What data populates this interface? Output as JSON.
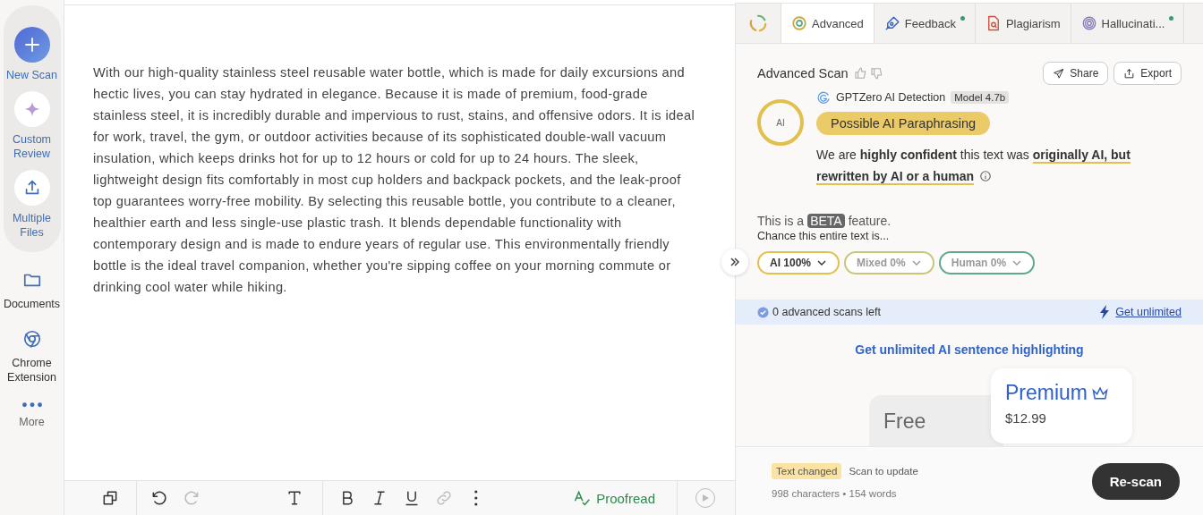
{
  "sidebar": {
    "actions": [
      {
        "label": "New Scan",
        "kind": "plus"
      },
      {
        "label": "Custom Review",
        "kind": "sparkle"
      },
      {
        "label": "Multiple Files",
        "kind": "upload"
      }
    ],
    "links": [
      {
        "label": "Documents",
        "kind": "folder"
      },
      {
        "label": "Chrome Extension",
        "kind": "chrome"
      },
      {
        "label": "More",
        "kind": "dots"
      }
    ]
  },
  "editor": {
    "text": "With our high-quality stainless steel reusable water bottle, which is made for daily excursions and hectic lives, you can stay hydrated in elegance. Because it is made of premium, food-grade stainless steel, it is incredibly durable and impervious to rust, stains, and offensive odors. It is ideal for work, travel, the gym, or outdoor activities because of its sophisticated double-wall vacuum insulation, which keeps drinks hot for up to 12 hours or cold for up to 24 hours. The sleek, lightweight design fits comfortably in most cup holders and backpack pockets, and the leak-proof top guarantees worry-free mobility. By selecting this reusable bottle, you contribute to a cleaner, healthier earth and less single-use plastic trash. It blends dependable functionality with contemporary design and is made to endure years of regular use. This environmentally friendly bottle is the ideal travel companion, whether you're sipping coffee on your morning commute or drinking cool water while hiking.",
    "toolbar": [
      {
        "kind": "copy",
        "disabled": false
      },
      {
        "kind": "undo",
        "disabled": false
      },
      {
        "kind": "redo",
        "disabled": true
      },
      {
        "kind": "text",
        "disabled": false
      },
      {
        "kind": "bold",
        "disabled": false
      },
      {
        "kind": "italic",
        "disabled": false
      },
      {
        "kind": "underline",
        "disabled": false
      },
      {
        "kind": "link",
        "disabled": true
      },
      {
        "kind": "more",
        "disabled": false
      }
    ],
    "proofread": "Proofread"
  },
  "panel": {
    "tabs": [
      {
        "kind": "status",
        "selected": false,
        "badge": false
      },
      {
        "kind": "advanced",
        "label": "Advanced",
        "selected": true,
        "badge": false
      },
      {
        "kind": "feedback",
        "label": "Feedback",
        "selected": false,
        "badge": true
      },
      {
        "kind": "plagiarism",
        "label": "Plagiarism",
        "selected": false,
        "badge": false
      },
      {
        "kind": "hallucination",
        "label": "Hallucinati...",
        "selected": false,
        "badge": true
      }
    ],
    "title": "Advanced Scan",
    "actions": [
      {
        "label": "Share",
        "kind": "share"
      },
      {
        "label": "Export",
        "kind": "export"
      }
    ],
    "detector": "GPTZero AI Detection",
    "model": "Model 4.7b",
    "score_label": "AI",
    "verdict": "Possible AI Paraphrasing",
    "statement": "We are **highly confident** this text was *originally AI, but rewritten by AI or a human*",
    "beta_prefix": "This is a",
    "beta_badge": "BETA",
    "beta_suffix": "feature.",
    "chance": "Chance this entire text is...",
    "chips": [
      {
        "label": "AI 100%",
        "selected": true,
        "color": "#e2c04f"
      },
      {
        "label": "Mixed 0%",
        "selected": false,
        "color": "#c9c57a"
      },
      {
        "label": "Human 0%",
        "selected": false,
        "color": "#5fa88a"
      }
    ],
    "banner": {
      "text": "0 advanced scans left",
      "link": "Get unlimited"
    },
    "upsell": "Get unlimited AI sentence highlighting",
    "plans": [
      {
        "kind": "free",
        "name": "Free"
      },
      {
        "kind": "premium",
        "name": "Premium",
        "price": "$12.99"
      }
    ],
    "footer": {
      "badge": "Text changed",
      "hint": "Scan to update",
      "stats": "998 characters • 154 words",
      "button": "Re-scan"
    }
  }
}
